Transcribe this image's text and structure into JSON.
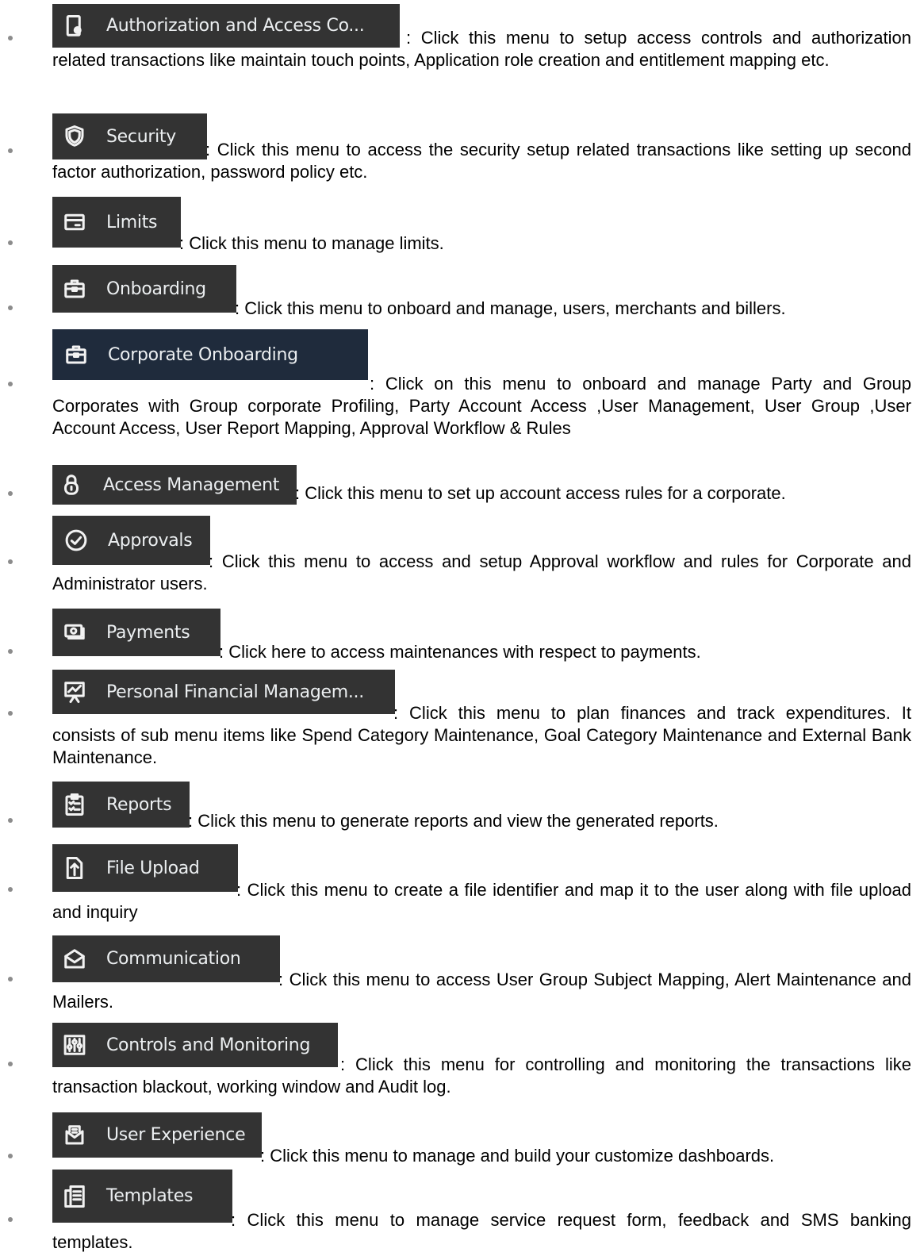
{
  "items": [
    {
      "label": "Authorization and Access Co...",
      "icon": "mobile-lock-icon",
      "description": ": Click this menu to setup access controls and authorization related transactions like maintain touch points, Application role creation and entitlement mapping etc."
    },
    {
      "label": "Security",
      "icon": "shield-icon",
      "description": ": Click this menu to access the security setup related transactions like setting up second factor authorization, password policy etc."
    },
    {
      "label": "Limits",
      "icon": "card-icon",
      "description": ": Click this menu to manage limits."
    },
    {
      "label": "Onboarding",
      "icon": "briefcase-icon",
      "description": ": Click this menu to onboard and manage, users, merchants and billers."
    },
    {
      "label": "Corporate Onboarding",
      "icon": "briefcase-icon",
      "description": ": Click on this menu to onboard and manage Party and Group Corporates with Group corporate Profiling, Party Account Access ,User Management, User Group ,User Account Access, User Report Mapping, Approval Workflow & Rules"
    },
    {
      "label": "Access Management",
      "icon": "lock-icon",
      "description": ": Click this menu to set up account access rules for a corporate."
    },
    {
      "label": "Approvals",
      "icon": "check-circle-icon",
      "description": ": Click this menu to access and setup  Approval workflow and rules  for Corporate and Administrator users."
    },
    {
      "label": "Payments",
      "icon": "money-icon",
      "description": ": Click here to access maintenances with respect to payments."
    },
    {
      "label": "Personal Financial Managem...",
      "icon": "chart-easel-icon",
      "description": ": Click this menu to plan finances and track expenditures. It consists of sub menu items like  Spend Category Maintenance, Goal Category Maintenance and External Bank Maintenance."
    },
    {
      "label": "Reports",
      "icon": "clipboard-list-icon",
      "description": ": Click this menu to generate reports and view the generated reports."
    },
    {
      "label": "File Upload",
      "icon": "file-upload-icon",
      "description": ": Click this menu to create a file identifier and map it to the user along with file upload and inquiry"
    },
    {
      "label": "Communication",
      "icon": "envelope-icon",
      "description": ": Click this menu to access User Group Subject Mapping, Alert Maintenance and Mailers."
    },
    {
      "label": "Controls and Monitoring",
      "icon": "sliders-icon",
      "description": ": Click this menu for controlling and monitoring the transactions like transaction blackout, working window and Audit log."
    },
    {
      "label": "User Experience",
      "icon": "dashboard-icon",
      "description": ":  Click this menu to manage and build your customize dashboards."
    },
    {
      "label": "Templates",
      "icon": "template-icon",
      "description": ": Click this menu to manage service request form, feedback and SMS banking templates."
    }
  ],
  "colors": {
    "button_bg": "#333333",
    "corporate_button_bg": "#1f2b3c",
    "bullet": "#8c8c8c"
  }
}
